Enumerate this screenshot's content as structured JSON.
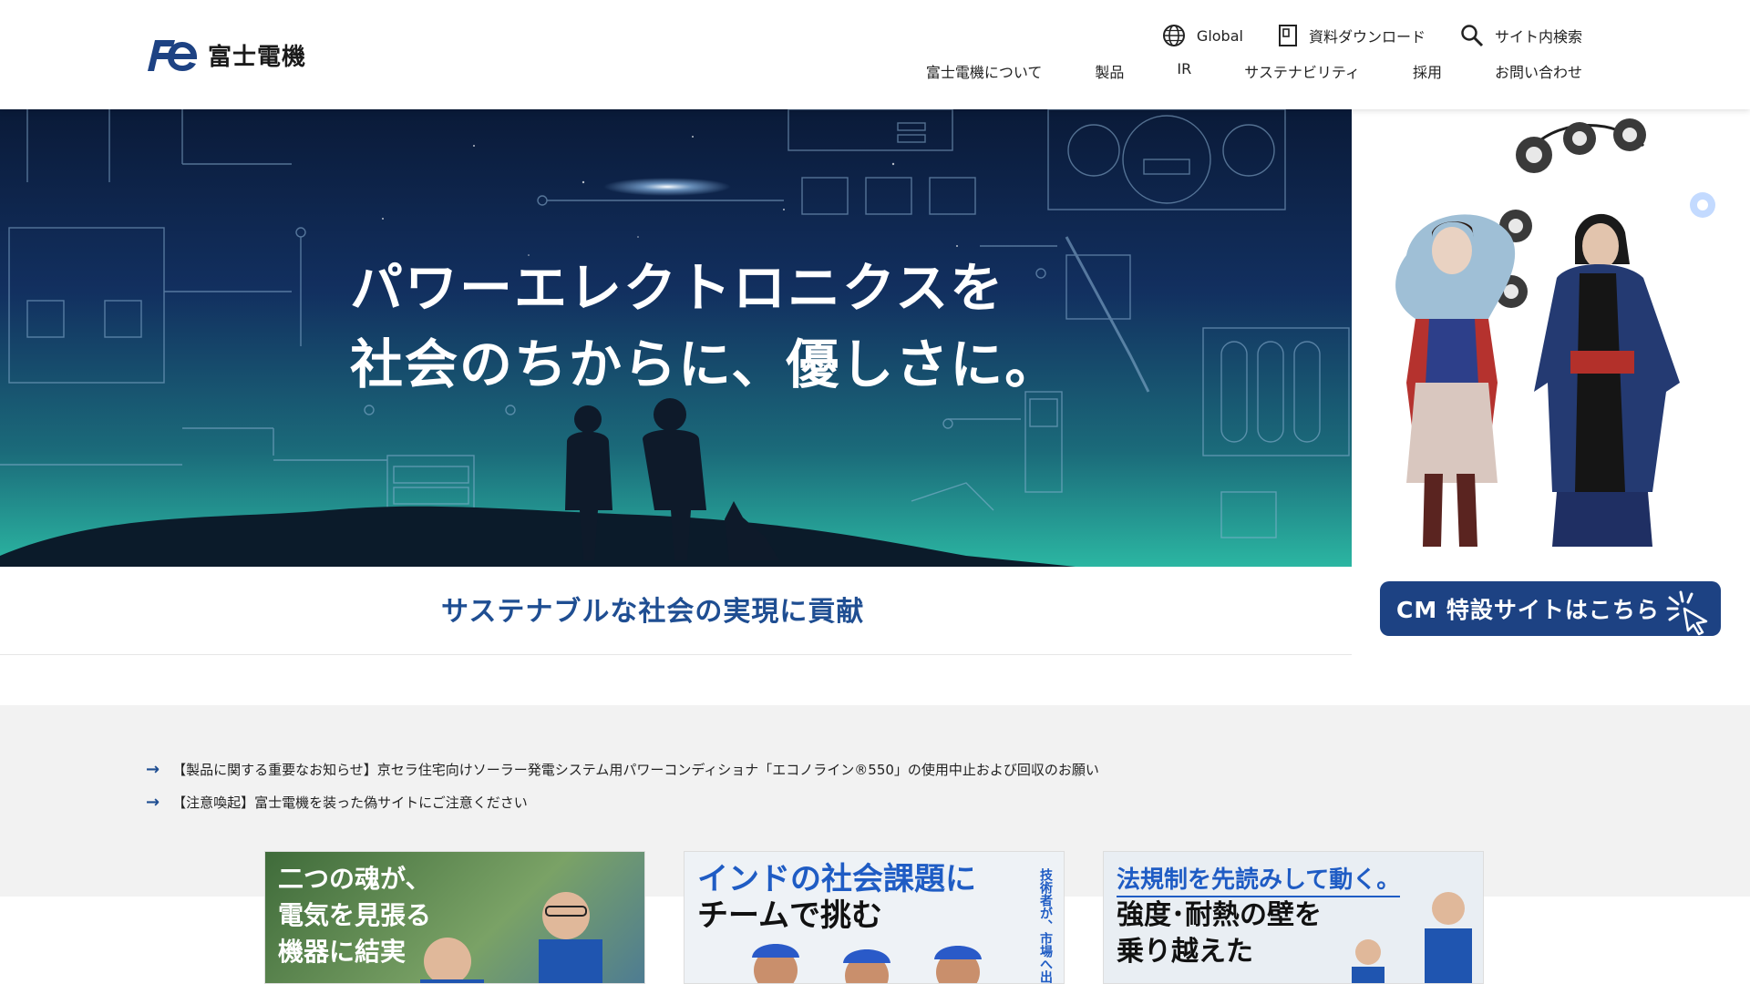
{
  "header": {
    "logo_text": "富士電機",
    "util": [
      {
        "label": "Global",
        "icon": "globe-icon"
      },
      {
        "label": "資料ダウンロード",
        "icon": "document-icon"
      },
      {
        "label": "サイト内検索",
        "icon": "search-icon"
      }
    ],
    "nav": [
      "富士電機について",
      "製品",
      "IR",
      "サステナビリティ",
      "採用",
      "お問い合わせ"
    ]
  },
  "hero": {
    "title_line1": "パワーエレクトロニクスを",
    "title_line2": "社会のちからに、優しさに。",
    "tagline": "サステナブルな社会の実現に貢献"
  },
  "cm": {
    "button_label": "CM 特設サイトはこちら"
  },
  "notices": [
    "【製品に関する重要なお知らせ】京セラ住宅向けソーラー発電システム用パワーコンディショナ「エコノライン®550」の使用中止および回収のお願い",
    "【注意喚起】富士電機を装った偽サイトにご注意ください"
  ],
  "cards": [
    {
      "title_line1": "二つの魂が、",
      "title_line2": "電気を見張る",
      "title_line3": "機器に結実"
    },
    {
      "title_line1": "インドの社会課題に",
      "title_line2": "チームで挑む",
      "side_text": "技術者が、市場へ出"
    },
    {
      "title_line1": "法規制を先読みして動く。",
      "title_line2": "強度･耐熱の壁を",
      "title_line3": "乗り越えた"
    }
  ],
  "colors": {
    "brand_blue": "#1d4283",
    "tagline_blue": "#1f4e92"
  }
}
